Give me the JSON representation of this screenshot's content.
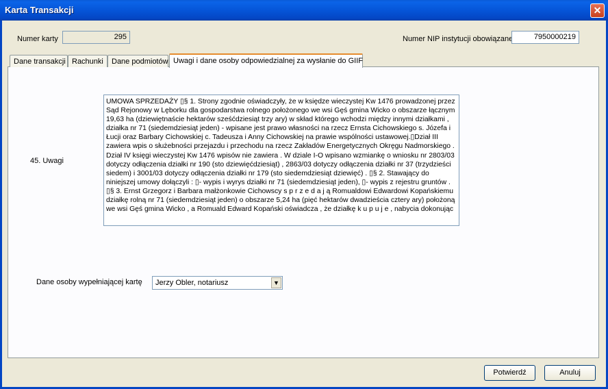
{
  "window": {
    "title": "Karta Transakcji",
    "close_symbol": "✕"
  },
  "header": {
    "card_number_label": "Numer karty",
    "card_number_value": "295",
    "nip_label": "Numer NIP instytucji obowiązanej",
    "nip_value": "7950000219"
  },
  "tabs": [
    {
      "label": "Dane transakcji"
    },
    {
      "label": "Rachunki"
    },
    {
      "label": "Dane podmiotów"
    },
    {
      "label": "Uwagi i dane osoby odpowiedzialnej za wysłanie do GIIF"
    }
  ],
  "main": {
    "remarks_label": "45. Uwagi",
    "remarks_text": "UMOWA  SPRZEDAŻY     ▯§ 1. Strony zgodnie oświadczyły, że w księdze wieczystej Kw 1476 prowadzonej  przez Sąd Rejonowy w  Lęborku dla gospodarstwa rolnego  położonego we wsi Gęś gmina Wicko  o obszarze łącznym 19,63 ha (dziewiętnaście hektarów sześćdziesiąt trzy ary) w skład którego wchodzi między innymi działkami , działka nr 71 (siedemdziesiąt jeden) - wpisane jest prawo własności na rzecz  Ernsta  Cichowskiego s. Józefa i Łucji oraz Barbary Cichowskiej c. Tadeusza i Anny Cichowskiej  na prawie wspólności  ustawowej.▯Dział III zawiera wpis o  służebności przejazdu i przechodu na rzecz Zakładów Energetycznych Okręgu Nadmorskiego . Dział IV księgi wieczystej Kw 1476 wpisów nie zawiera .  W dziale I-O wpisano wzmiankę o wniosku nr 2803/03 dotyczy odłączenia działki nr 190 (sto dziewięćdziesiąt) , 2863/03 dotyczy odłączenia działki nr 37 (trzydzieści siedem) i 3001/03 dotyczy odłączenia działki nr 179 (sto siedemdziesiąt dziewięć) . ▯§ 2. Stawający do niniejszej umowy dołączyli : ▯- wypis i wyrys  działki nr 71 (siedemdziesiąt jeden), ▯- wypis z rejestru gruntów . ▯§ 3. Ernst Grzegorz i Barbara małżonkowie Cichowscy  s p r z e d a j ą  Romualdowi Edwardowi Kopańskiemu działkę rolną nr 71 (siedemdziesiąt jeden)  o obszarze 5,24 ha (pięć hektarów dwadzieścia cztery ary)  położoną we wsi Gęś gmina Wicko ,  a  Romuald Edward Kopański  oświadcza , że  działkę     k u p u j e ,  nabycia dokonując",
    "person_label": "Dane osoby wypełniającej kartę",
    "person_value": "Jerzy Obler, notariusz",
    "dropdown_arrow": "▼"
  },
  "footer": {
    "confirm_label": "Potwierdź",
    "cancel_label": "Anuluj"
  }
}
